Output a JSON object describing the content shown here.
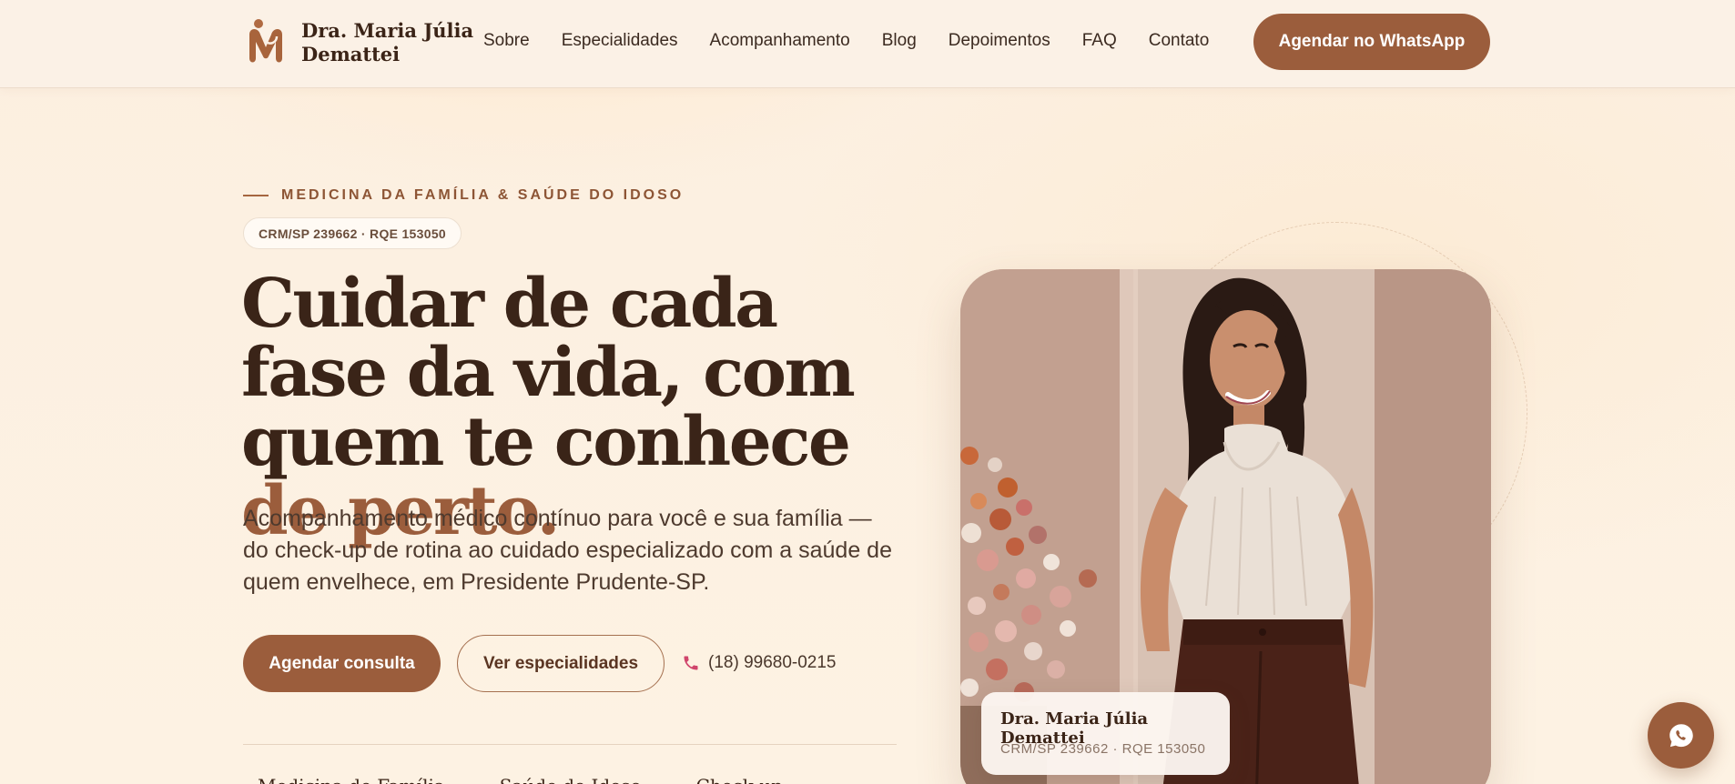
{
  "header": {
    "logo_alt": "M monogram logo",
    "name_line1": "Dra. Maria Júlia",
    "name_line2": "Demattei",
    "nav": [
      "Sobre",
      "Especialidades",
      "Acompanhamento",
      "Blog",
      "Depoimentos",
      "FAQ",
      "Contato"
    ],
    "cta_label": "Agendar no WhatsApp"
  },
  "hero": {
    "eyebrow": "MEDICINA DA FAMÍLIA & SAÚDE DO IDOSO",
    "badge": "CRM/SP 239662 · RQE 153050",
    "headline_part1": "Cuidar de cada fase da vida, com quem te conhece ",
    "headline_accent": "de perto.",
    "subtext": "Acompanhamento médico contínuo para você e sua família — do check-up de rotina ao cuidado especializado com a saúde de quem envelhece, em Presidente Prudente-SP.",
    "primary_button": "Agendar consulta",
    "secondary_button": "Ver especialidades",
    "phone": "(18) 99680-0215",
    "bottom_items": [
      "Medicina de Família",
      "Saúde do Idoso",
      "Check-up"
    ]
  },
  "photo_card": {
    "name": "Dra. Maria Júlia Demattei",
    "credentials": "CRM/SP 239662 · RQE 153050"
  },
  "colors": {
    "accent": "#9b5d3c",
    "background": "#fdf1e2",
    "text_dark": "#3a2418"
  },
  "icons": {
    "logo": "m-monogram-icon",
    "phone": "phone-icon",
    "whatsapp": "whatsapp-icon"
  }
}
